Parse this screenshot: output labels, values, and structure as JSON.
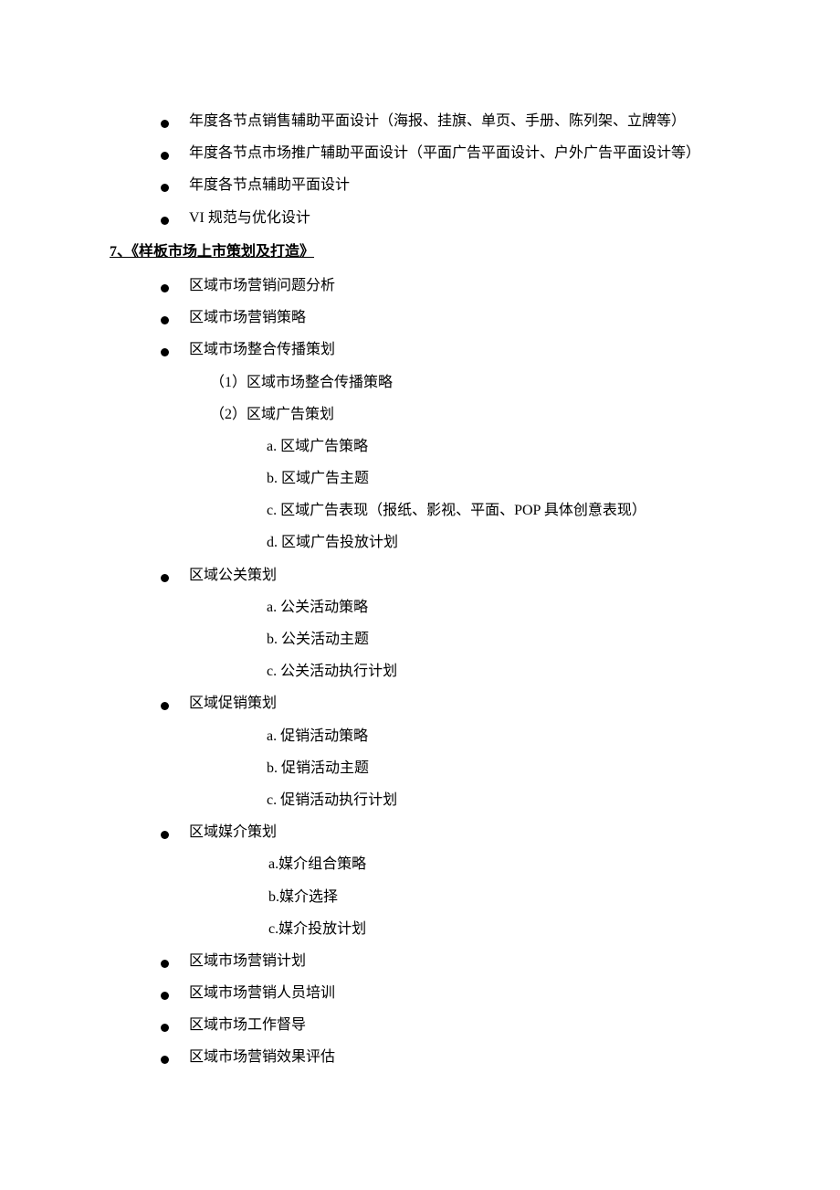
{
  "top_bullets": [
    "年度各节点销售辅助平面设计（海报、挂旗、单页、手册、陈列架、立牌等）",
    "年度各节点市场推广辅助平面设计（平面广告平面设计、户外广告平面设计等）",
    "年度各节点辅助平面设计",
    "VI 规范与优化设计"
  ],
  "heading": "7、《样板市场上市策划及打造》",
  "section": {
    "b1": "区域市场营销问题分析",
    "b2": "区域市场营销策略",
    "b3": "区域市场整合传播策划",
    "b3_sub": [
      "（1）区域市场整合传播策略",
      "（2）区域广告策划"
    ],
    "b3_sub2": [
      "a. 区域广告策略",
      "b. 区域广告主题",
      "c. 区域广告表现（报纸、影视、平面、POP 具体创意表现）",
      "d. 区域广告投放计划"
    ],
    "b4": "区域公关策划",
    "b4_sub2": [
      "a. 公关活动策略",
      "b. 公关活动主题",
      "c. 公关活动执行计划"
    ],
    "b5": "区域促销策划",
    "b5_sub2": [
      "a. 促销活动策略",
      "b. 促销活动主题",
      "c. 促销活动执行计划"
    ],
    "b6": "区域媒介策划",
    "b6_sub2": [
      "a.媒介组合策略",
      "b.媒介选择",
      "c.媒介投放计划"
    ],
    "b7": "区域市场营销计划",
    "b8": "区域市场营销人员培训",
    "b9": "区域市场工作督导",
    "b10": "区域市场营销效果评估"
  }
}
